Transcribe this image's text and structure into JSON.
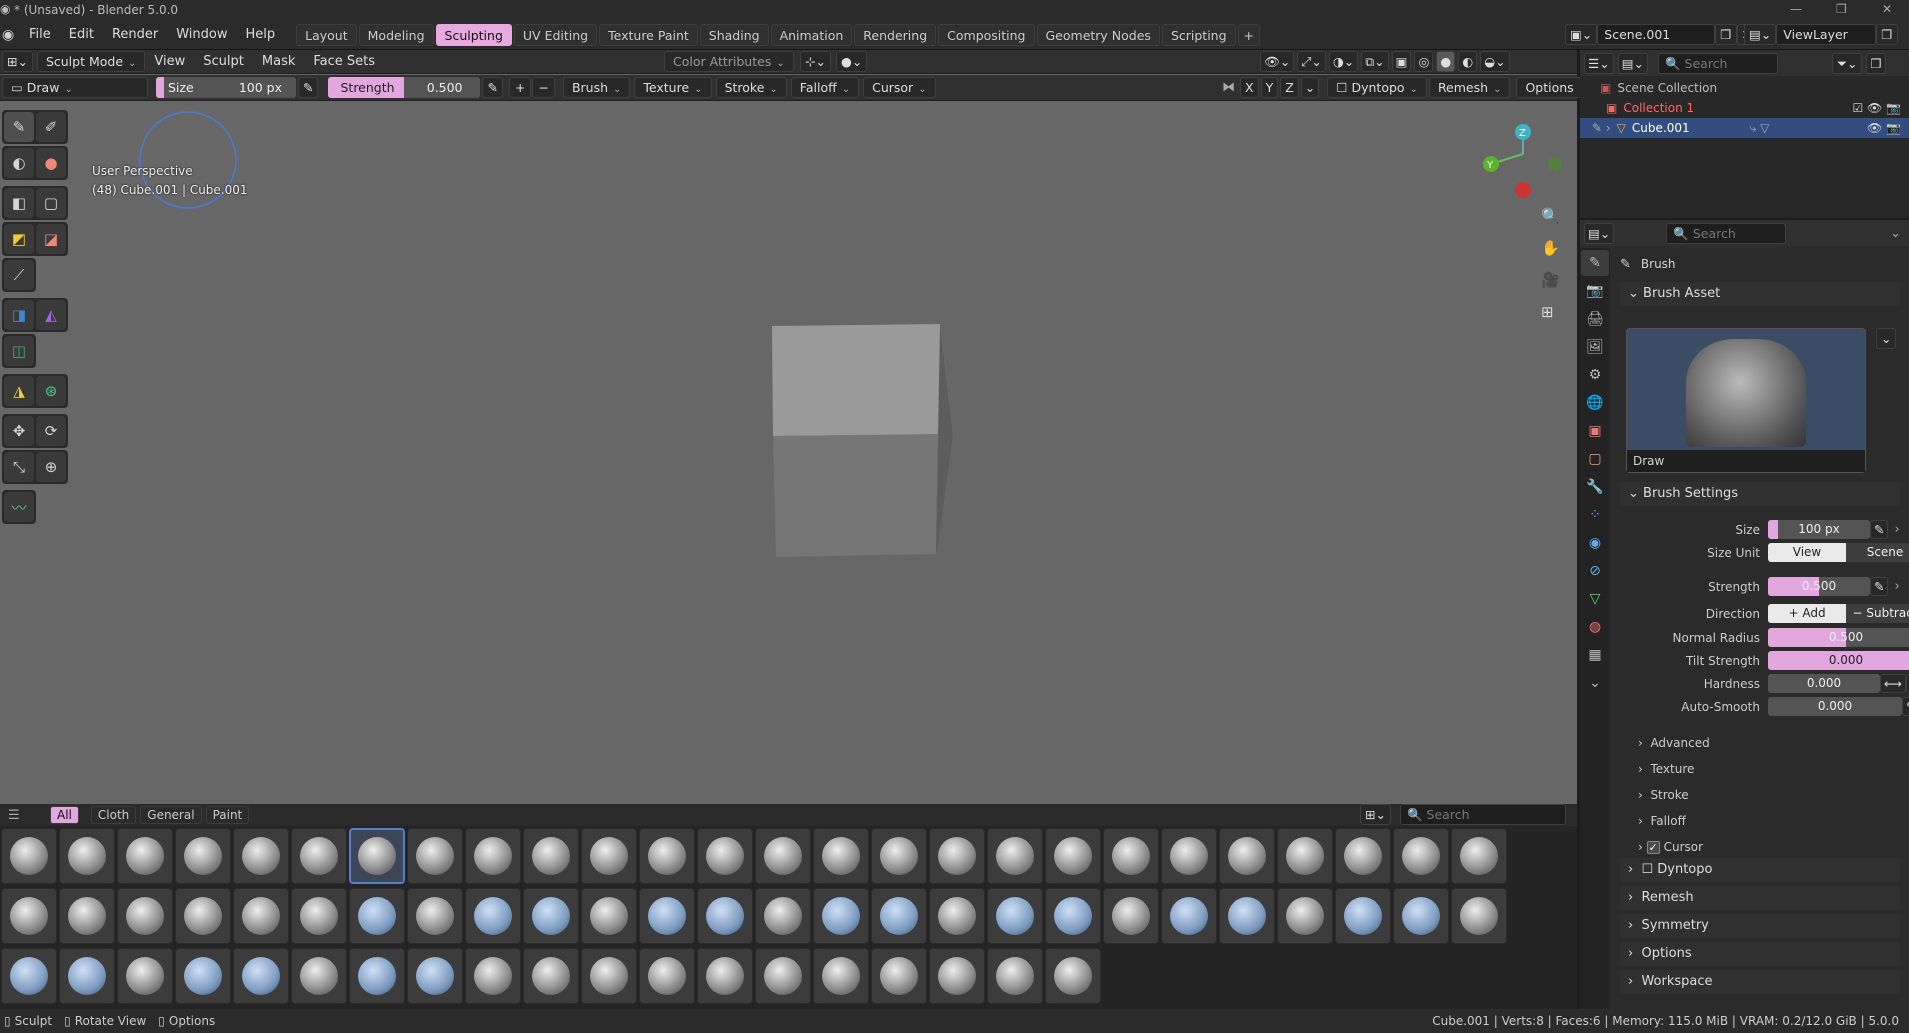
{
  "window": {
    "title": "* (Unsaved) - Blender 5.0.0"
  },
  "menu": [
    "File",
    "Edit",
    "Render",
    "Window",
    "Help"
  ],
  "workspaces": [
    "Layout",
    "Modeling",
    "Sculpting",
    "UV Editing",
    "Texture Paint",
    "Shading",
    "Animation",
    "Rendering",
    "Compositing",
    "Geometry Nodes",
    "Scripting"
  ],
  "active_workspace": "Sculpting",
  "scene": {
    "name": "Scene.001",
    "view_layer": "ViewLayer"
  },
  "header": {
    "mode": "Sculpt Mode",
    "view": "View",
    "sculpt": "Sculpt",
    "mask": "Mask",
    "face_sets": "Face Sets",
    "color_attributes": "Color Attributes"
  },
  "tool_header": {
    "brush_name": "Draw",
    "size_label": "Size",
    "size_value": "100 px",
    "strength_label": "Strength",
    "strength_value": "0.500",
    "plus": "+",
    "minus": "−",
    "menus": [
      "Brush",
      "Texture",
      "Stroke",
      "Falloff",
      "Cursor"
    ],
    "axes": [
      "X",
      "Y",
      "Z"
    ],
    "dyntopo": "Dyntopo",
    "remesh": "Remesh",
    "options": "Options",
    "strength_fraction": 0.5
  },
  "viewport": {
    "perspective": "User Perspective",
    "object_info": "(48) Cube.001 | Cube.001",
    "gizmo": {
      "z": "Z",
      "y": "Y"
    }
  },
  "shelf": {
    "tabs": [
      "All",
      "Cloth",
      "General",
      "Paint"
    ],
    "active_tab": "All",
    "search_placeholder": "Search",
    "brush_count": 71,
    "selected_index": 6
  },
  "outliner": {
    "search_placeholder": "Search",
    "scene_collection": "Scene Collection",
    "collection": "Collection 1",
    "object": "Cube.001"
  },
  "properties": {
    "search_placeholder": "Search",
    "brush_label": "Brush",
    "brush_asset": "Brush Asset",
    "asset_name": "Draw",
    "brush_settings": "Brush Settings",
    "size": {
      "label": "Size",
      "value": "100 px",
      "fraction": 0.1
    },
    "size_unit": {
      "label": "Size Unit",
      "options": [
        "View",
        "Scene"
      ],
      "active": "View"
    },
    "strength": {
      "label": "Strength",
      "value": "0.500",
      "fraction": 0.5
    },
    "direction": {
      "label": "Direction",
      "options": [
        "Add",
        "Subtract"
      ],
      "plus": "+",
      "minus": "−"
    },
    "normal_radius": {
      "label": "Normal Radius",
      "value": "0.500",
      "fraction": 0.5
    },
    "tilt_strength": {
      "label": "Tilt Strength",
      "value": "0.000"
    },
    "hardness": {
      "label": "Hardness",
      "value": "0.000"
    },
    "auto_smooth": {
      "label": "Auto-Smooth",
      "value": "0.000"
    },
    "subpanels": [
      "Advanced",
      "Texture",
      "Stroke",
      "Falloff",
      "Cursor"
    ],
    "cursor_checked": true,
    "panels": [
      "Dyntopo",
      "Remesh",
      "Symmetry",
      "Options",
      "Workspace"
    ]
  },
  "status": {
    "left": [
      "Sculpt",
      "Rotate View",
      "Options"
    ],
    "right": "Cube.001 | Verts:8 | Faces:6 | Memory: 115.0 MiB | VRAM: 0.2/12.0 GiB | 5.0.0"
  },
  "colors": {
    "accent": "#e3a7df",
    "select": "#5680c2",
    "viewport": "#676767"
  }
}
